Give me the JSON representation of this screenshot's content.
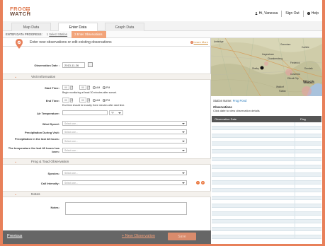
{
  "header": {
    "logo_line1": "FROG",
    "logo_line2": "WATCH",
    "user_greeting": "Hi, Vanessa",
    "sign_out": "Sign Out",
    "help": "Help",
    "brand_color": "#e8805a"
  },
  "nav": {
    "tabs": [
      {
        "label": "Map Data",
        "active": false
      },
      {
        "label": "Enter Data",
        "active": true
      },
      {
        "label": "Graph Data",
        "active": false
      }
    ]
  },
  "progress": {
    "label": "ENTER DATA PROGRESS:",
    "step1": "1",
    "step1_link": "Select Station",
    "step2": "2 Enter Observations"
  },
  "form": {
    "header_text": "Enter new observations or edit existing observations",
    "learn_more": "Learn More",
    "observation_date_label": "Observation Date :",
    "observation_date_value": "2013-11-26",
    "visit_section": "Visit Information",
    "start_time_label": "Start Time:",
    "start_hour": "00",
    "start_min": "00",
    "am": "AM",
    "pm": "PM",
    "start_hint": "Begin monitoring at least 30 minutes after sunset.",
    "end_time_label": "End Time:",
    "end_hour": "00",
    "end_min": "00",
    "end_hint": "End time should be exactly three minutes after start time.",
    "air_temp_label": "Air Temperature:",
    "air_temp_unit": "°F",
    "wind_label": "Wind Speed:",
    "precip_label": "Precipitation During Visit:",
    "precip48_label": "Precipitation in the last 48 hours:",
    "temp48_label": "The temperature the last 48 hours has been:",
    "select_placeholder": "Select one...",
    "frog_section": "Frog & Toad Observation",
    "species_label": "Species:",
    "call_label": "Call Intensity:",
    "notes_section": "Notes",
    "notes_label": "Notes:"
  },
  "footer": {
    "previous": "Previous",
    "new_observation": "+ New Observation",
    "save": "Save"
  },
  "map": {
    "labels": [
      "Ambridge",
      "Greentree",
      "Carlisle",
      "Frederick",
      "Hagerstown",
      "Chambersburg",
      "Shelby",
      "Dundalk",
      "Columbia",
      "Ellicott City",
      "Waldorf",
      "Fairfax",
      "Wash"
    ]
  },
  "station": {
    "label": "Station Name:",
    "name": "Frog Pond",
    "observations_heading": "Observations",
    "observations_sub": "Click date to view observation details"
  },
  "obs_table": {
    "col1": "Observation Date",
    "col2": "Flag"
  }
}
